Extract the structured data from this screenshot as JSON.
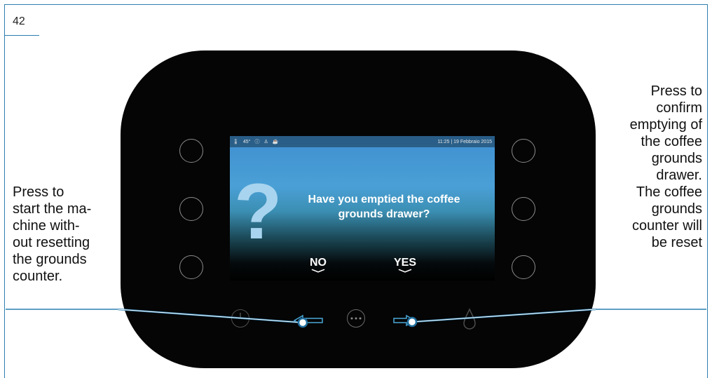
{
  "page_number": "42",
  "status_bar": {
    "left_text": "45°",
    "right_text": "11:25 | 19 Febbraio 2015"
  },
  "screen": {
    "question_line1": "Have you emptied the coffee",
    "question_line2": "grounds drawer?",
    "no_label": "NO",
    "yes_label": "YES"
  },
  "callouts": {
    "left": [
      "Press to",
      "start the ma-",
      "chine with-",
      "out resetting",
      "the grounds",
      "counter."
    ],
    "right": [
      "Press to",
      "confirm",
      "emptying of",
      "the coffee",
      "grounds",
      "drawer.",
      "The coffee",
      "grounds",
      "counter will",
      "be reset"
    ]
  },
  "icons": {
    "question": "question-mark-icon",
    "left_arrow": "left-arrow-icon",
    "right_arrow": "right-arrow-icon",
    "menu": "more-dots-icon",
    "power": "power-icon",
    "drop": "water-drop-icon"
  },
  "colors": {
    "accent": "#2d7fb0",
    "panel": "#050505",
    "screen_top": "#3f8fd0"
  }
}
